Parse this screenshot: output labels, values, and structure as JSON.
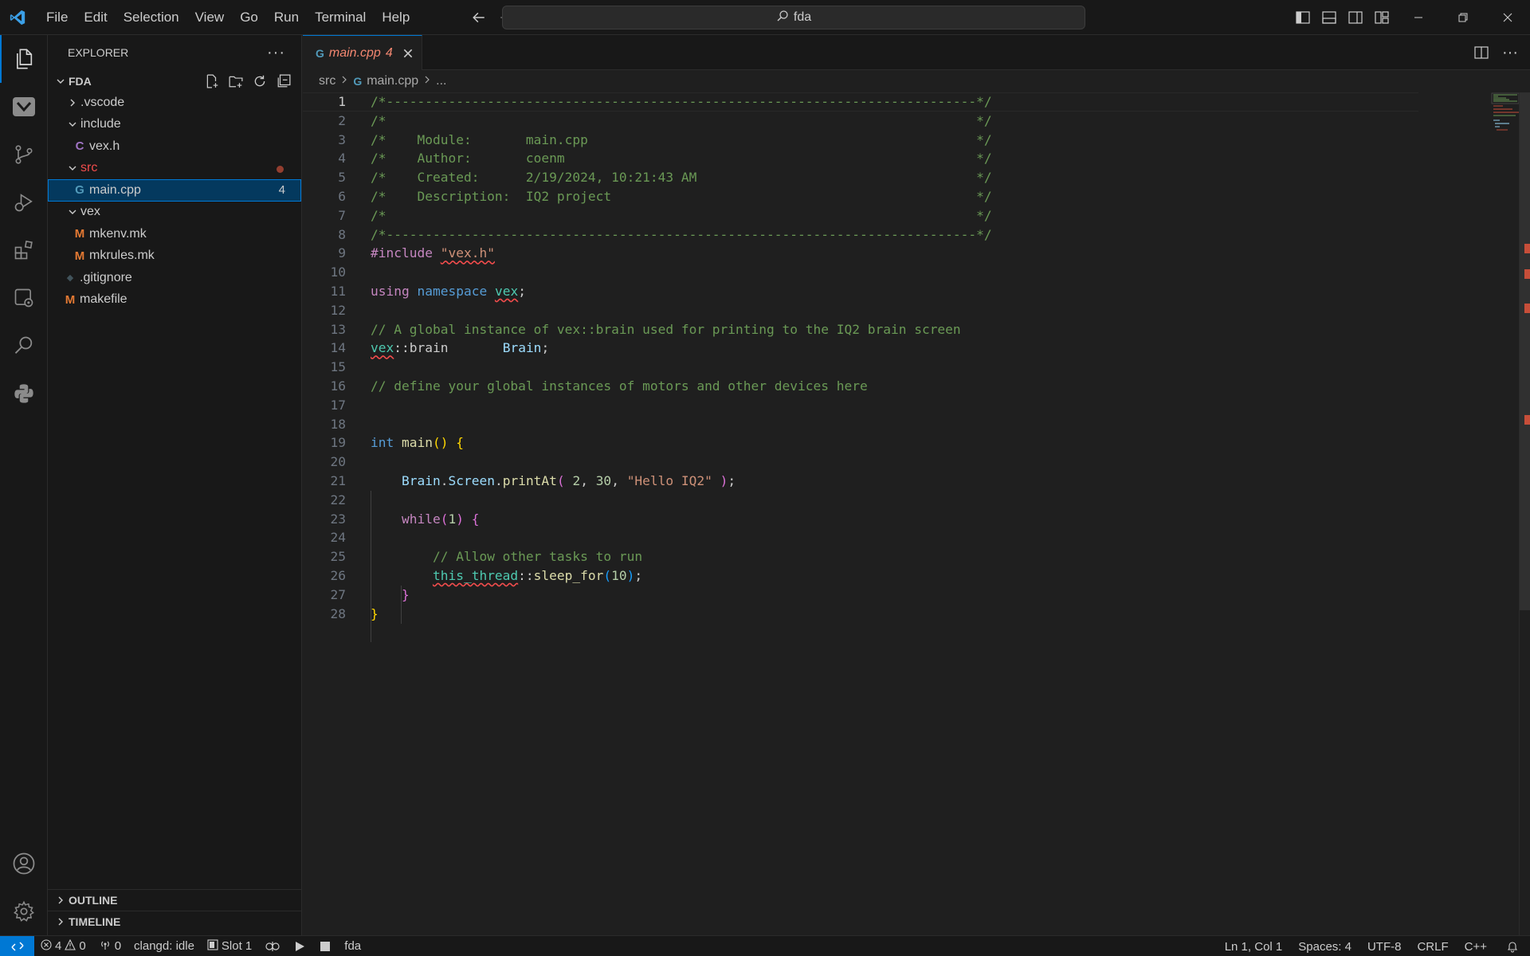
{
  "titlebar": {
    "menu": [
      "File",
      "Edit",
      "Selection",
      "View",
      "Go",
      "Run",
      "Terminal",
      "Help"
    ],
    "search_text": "fda"
  },
  "sidebar": {
    "title": "EXPLORER",
    "more": "···",
    "folder": "FDA",
    "tree": [
      {
        "label": ".vscode",
        "kind": "folder-collapsed",
        "depth": 1
      },
      {
        "label": "include",
        "kind": "folder-open",
        "depth": 1
      },
      {
        "label": "vex.h",
        "kind": "c-file",
        "icon": "C",
        "depth": 2
      },
      {
        "label": "src",
        "kind": "folder-open",
        "depth": 1,
        "status": "modified-error"
      },
      {
        "label": "main.cpp",
        "kind": "cpp-file",
        "icon": "G",
        "depth": 2,
        "badge": "4",
        "selected": true
      },
      {
        "label": "vex",
        "kind": "folder-open",
        "depth": 1
      },
      {
        "label": "mkenv.mk",
        "kind": "make-file",
        "icon": "M",
        "depth": 2
      },
      {
        "label": "mkrules.mk",
        "kind": "make-file",
        "icon": "M",
        "depth": 2
      },
      {
        "label": ".gitignore",
        "kind": "git-file",
        "icon": "◆",
        "depth": 1
      },
      {
        "label": "makefile",
        "kind": "make-file",
        "icon": "M",
        "depth": 1
      }
    ],
    "outline": "OUTLINE",
    "timeline": "TIMELINE"
  },
  "editor": {
    "tab_label": "main.cpp",
    "tab_badge": "4",
    "breadcrumb": [
      "src",
      "main.cpp",
      "..."
    ],
    "line_count": 28
  },
  "statusbar": {
    "errors": "4",
    "warnings": "0",
    "ports": "0",
    "clangd": "clangd: idle",
    "slot": "Slot 1",
    "project": "fda",
    "position": "Ln 1, Col 1",
    "spaces": "Spaces: 4",
    "encoding": "UTF-8",
    "eol": "CRLF",
    "language": "C++"
  },
  "colors": {
    "accent": "#0078d4",
    "error": "#f14c4c",
    "comment": "#6a9955",
    "keyword": "#569cd6"
  }
}
